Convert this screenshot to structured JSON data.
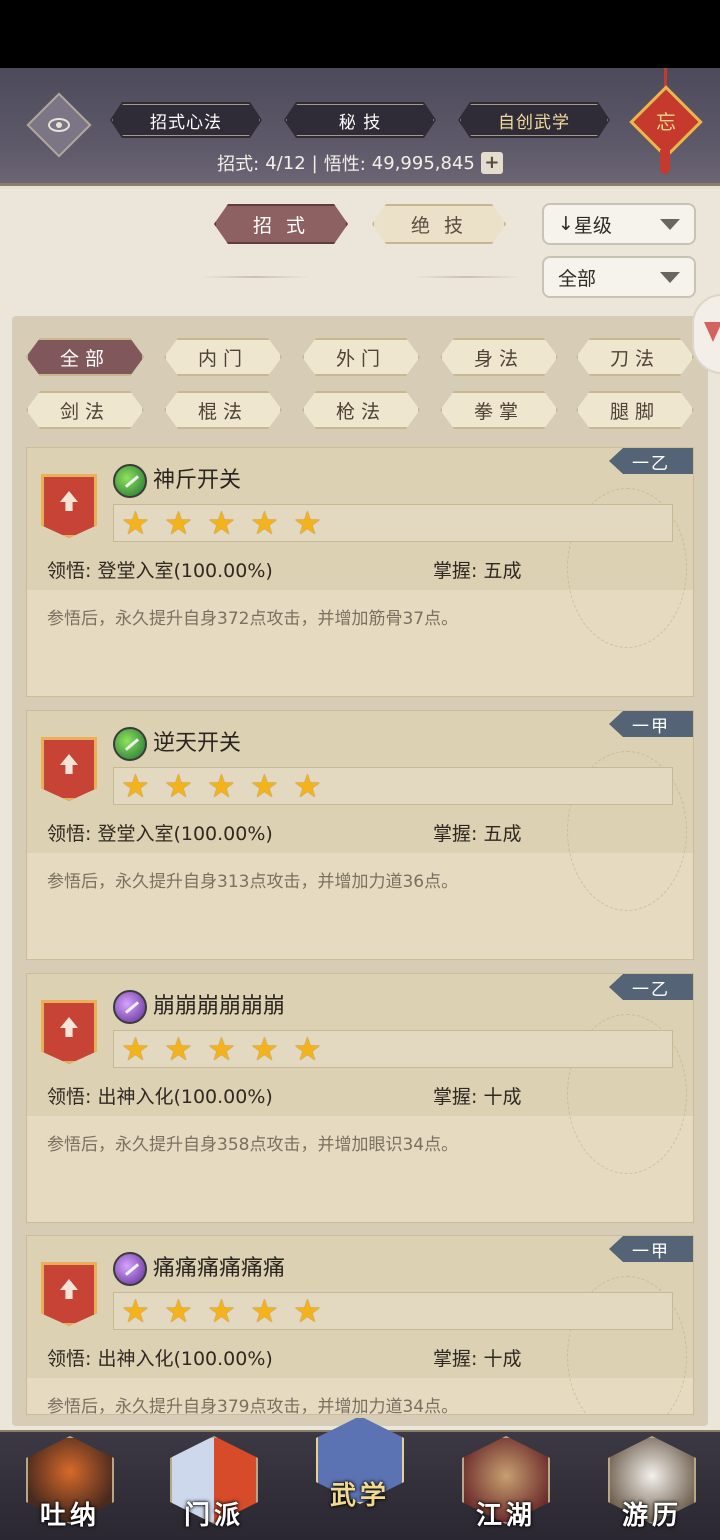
{
  "top_tabs": [
    "招式心法",
    "秘 技",
    "自创武学"
  ],
  "knot_char": "忘",
  "stats": {
    "zhaoshi_label": "招式:",
    "zhaoshi_value": "4/12",
    "sep": "|",
    "wuxing_label": "悟性:",
    "wuxing_value": "49,995,845",
    "plus": "+"
  },
  "mode_tabs": [
    "招 式",
    "绝 技"
  ],
  "sort": {
    "arrow": "↓",
    "label": "星级"
  },
  "filter": {
    "label": "全部"
  },
  "categories": [
    "全部",
    "内门",
    "外门",
    "身法",
    "刀法",
    "剑法",
    "棍法",
    "枪法",
    "拳掌",
    "腿脚"
  ],
  "skills": [
    {
      "tier": "一乙",
      "name": "神斤开关",
      "icon": "green-blade-icon",
      "stars": 5,
      "lingwu_label": "领悟:",
      "lingwu_value": "登堂入室(100.00%)",
      "zhangwo_label": "掌握:",
      "zhangwo_value": "五成",
      "desc": "参悟后，永久提升自身372点攻击，并增加筋骨37点。"
    },
    {
      "tier": "一甲",
      "name": "逆天开关",
      "icon": "green-blade-icon",
      "stars": 5,
      "lingwu_label": "领悟:",
      "lingwu_value": "登堂入室(100.00%)",
      "zhangwo_label": "掌握:",
      "zhangwo_value": "五成",
      "desc": "参悟后，永久提升自身313点攻击，并增加力道36点。"
    },
    {
      "tier": "一乙",
      "name": "崩崩崩崩崩崩",
      "icon": "purple-spear-icon",
      "stars": 5,
      "lingwu_label": "领悟:",
      "lingwu_value": "出神入化(100.00%)",
      "zhangwo_label": "掌握:",
      "zhangwo_value": "十成",
      "desc": "参悟后，永久提升自身358点攻击，并增加眼识34点。"
    },
    {
      "tier": "一甲",
      "name": "痛痛痛痛痛痛",
      "icon": "purple-spear-icon",
      "stars": 5,
      "lingwu_label": "领悟:",
      "lingwu_value": "出神入化(100.00%)",
      "zhangwo_label": "掌握:",
      "zhangwo_value": "十成",
      "desc": "参悟后，永久提升自身379点攻击，并增加力道34点。"
    }
  ],
  "bottom_nav": [
    {
      "label": "吐纳",
      "icon": "meditation-monk-icon"
    },
    {
      "label": "门派",
      "icon": "sect-banner-icon"
    },
    {
      "label": "武学",
      "icon": "martial-book-icon",
      "active": true
    },
    {
      "label": "江湖",
      "icon": "straw-hat-icon"
    },
    {
      "label": "游历",
      "icon": "white-horse-icon"
    }
  ]
}
